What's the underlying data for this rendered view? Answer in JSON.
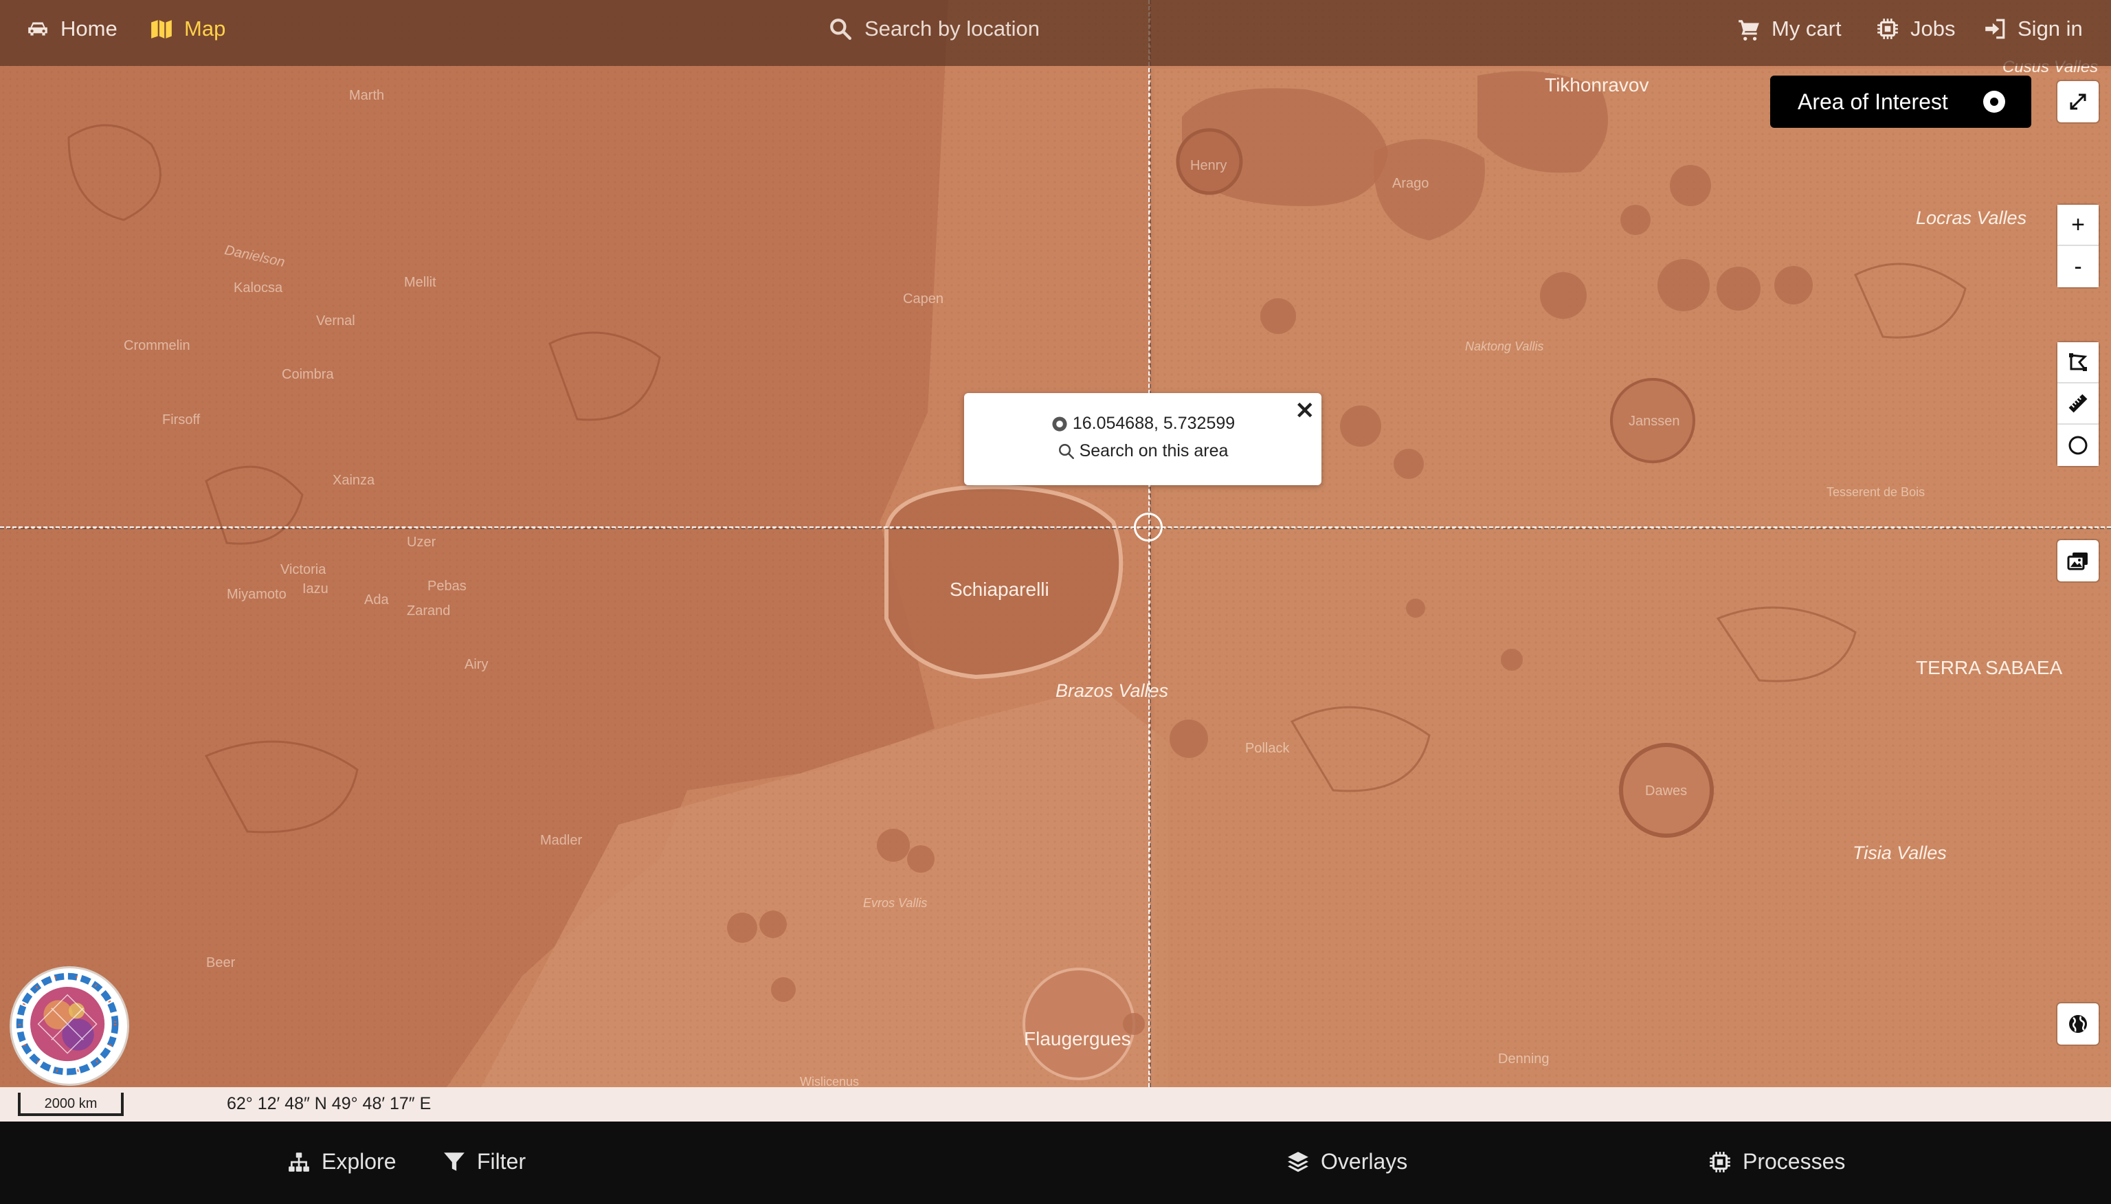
{
  "nav": {
    "home_label": "Home",
    "map_label": "Map",
    "cart_label": "My cart",
    "jobs_label": "Jobs",
    "signin_label": "Sign in"
  },
  "search": {
    "placeholder": "Search by location"
  },
  "aoi": {
    "label": "Area of Interest"
  },
  "tools": {
    "zoom_in": "+",
    "zoom_out": "-"
  },
  "popup": {
    "coordinates": "16.054688, 5.732599",
    "search_area_label": "Search on this area"
  },
  "map_labels": {
    "strong": [
      "Tikhonravov",
      "Schiaparelli",
      "Flaugergues",
      "TERRA SABAEA"
    ],
    "valles": [
      "Locras Valles",
      "Brazos Valles",
      "Tisia Valles",
      "Cusus Valles"
    ],
    "faint": [
      "Marth",
      "Danielson",
      "Kalocsa",
      "Mellit",
      "Vernal",
      "Crommelin",
      "Coimbra",
      "Firsoff",
      "Xainza",
      "Victoria",
      "Iazu",
      "Miyamoto",
      "Ada",
      "Pebas",
      "Zarand",
      "Uzer",
      "Airy",
      "Henry",
      "Arago",
      "Capen",
      "Naktong Vallis",
      "Janssen",
      "Tesserent de Bois",
      "Pollack",
      "Dawes",
      "Madler",
      "Evros Vallis",
      "Beer",
      "Denning",
      "Wislicenus"
    ]
  },
  "status": {
    "scale_label": "2000 km",
    "cursor_coords": "62° 12′ 48″ N 49° 48′ 17″ E"
  },
  "bottom": {
    "explore_label": "Explore",
    "filter_label": "Filter",
    "overlays_label": "Overlays",
    "processes_label": "Processes"
  },
  "colors": {
    "map_base": "#c8825f",
    "topbar": "#5c3422",
    "active_nav": "#ffd24a",
    "bottom_bar": "#0e0e0f"
  },
  "icons": {
    "home": "car-icon",
    "map": "map-icon",
    "search": "search-icon",
    "cart": "cart-icon",
    "jobs": "chip-icon",
    "signin": "sign-in-icon",
    "fullscreen": "expand-icon",
    "polygon": "draw-polygon-icon",
    "ruler": "ruler-icon",
    "circle": "circle-icon",
    "image": "images-icon",
    "globe": "globe-icon",
    "explore": "sitemap-icon",
    "filter": "filter-icon",
    "overlays": "layers-icon",
    "processes": "chip-icon"
  }
}
